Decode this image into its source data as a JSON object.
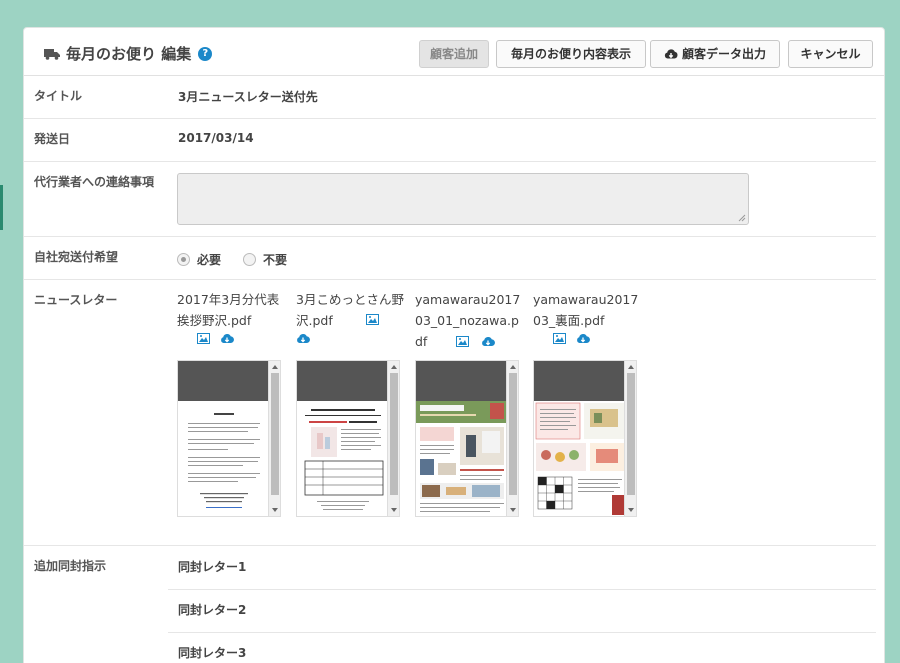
{
  "header": {
    "title": "毎月のお便り 編集",
    "help": "?",
    "buttons": {
      "add_customer": "顧客追加",
      "show_content": "毎月のお便り内容表示",
      "export_customers": "顧客データ出力",
      "cancel": "キャンセル"
    }
  },
  "fields": {
    "title_label": "タイトル",
    "title_value": "3月ニュースレター送付先",
    "date_label": "発送日",
    "date_value": "2017/03/14",
    "notes_label": "代行業者への連絡事項",
    "notes_value": "",
    "self_send_label": "自社宛送付希望",
    "self_send_options": [
      "必要",
      "不要"
    ],
    "self_send_selected": "必要",
    "newsletter_label": "ニュースレター",
    "enclosure_label": "追加同封指示"
  },
  "newsletters": [
    {
      "name": "2017年3月分代表挨拶野沢.pdf"
    },
    {
      "name": "3月こめっとさん野沢.pdf"
    },
    {
      "name": "yamawarau201703_01_nozawa.pdf"
    },
    {
      "name": "yamawarau201703_裏面.pdf"
    }
  ],
  "enclosures": [
    "同封レター1",
    "同封レター2",
    "同封レター3"
  ],
  "colors": {
    "accent": "#1b88c9",
    "background": "#9dd3c3"
  }
}
